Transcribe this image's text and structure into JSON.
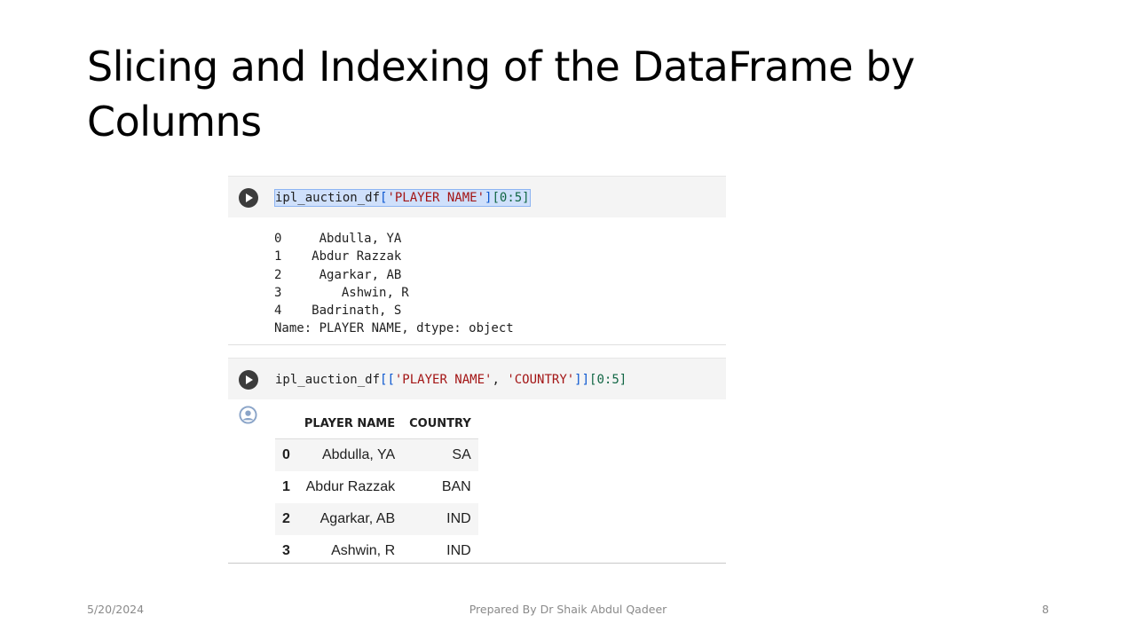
{
  "slide": {
    "title": "Slicing and Indexing of the DataFrame by Columns"
  },
  "cell1": {
    "code": {
      "var": "ipl_auction_df",
      "open": "[",
      "str": "'PLAYER NAME'",
      "close": "]",
      "slice": "[0:5]"
    },
    "output_rows": [
      {
        "index": "0",
        "value": "Abdulla, YA"
      },
      {
        "index": "1",
        "value": "Abdur Razzak"
      },
      {
        "index": "2",
        "value": "Agarkar, AB"
      },
      {
        "index": "3",
        "value": "Ashwin, R"
      },
      {
        "index": "4",
        "value": "Badrinath, S"
      }
    ],
    "output_footer": "Name: PLAYER NAME, dtype: object"
  },
  "cell2": {
    "code": {
      "var": "ipl_auction_df",
      "open": "[[",
      "str1": "'PLAYER NAME'",
      "comma": ", ",
      "str2": "'COUNTRY'",
      "close": "]]",
      "slice": "[0:5]"
    },
    "table": {
      "columns": [
        "",
        "PLAYER NAME",
        "COUNTRY"
      ],
      "rows": [
        [
          "0",
          "Abdulla, YA",
          "SA"
        ],
        [
          "1",
          "Abdur Razzak",
          "BAN"
        ],
        [
          "2",
          "Agarkar, AB",
          "IND"
        ],
        [
          "3",
          "Ashwin, R",
          "IND"
        ]
      ]
    }
  },
  "footer": {
    "date": "5/20/2024",
    "center": "Prepared By Dr Shaik Abdul Qadeer",
    "page": "8"
  },
  "icons": {
    "run": "play-circle-icon",
    "output": "user-circle-icon"
  },
  "colors": {
    "selection": "#cfe0fb",
    "string": "#a31515",
    "bracket": "#0b57d0",
    "number": "#116644"
  }
}
